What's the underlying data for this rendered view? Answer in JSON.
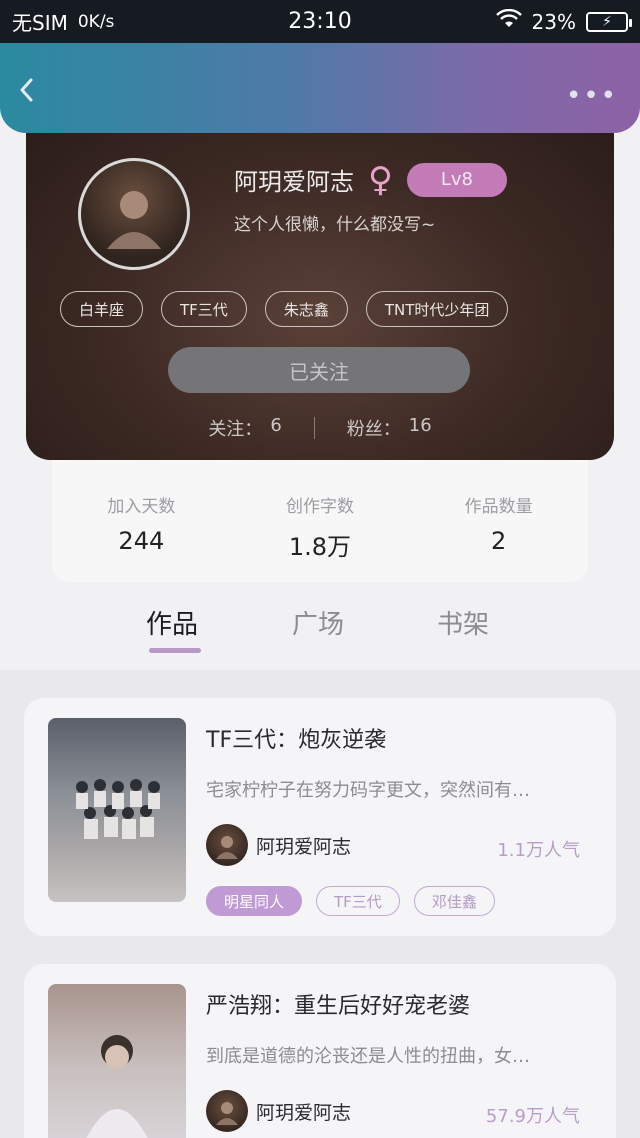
{
  "status_bar": {
    "carrier": "无SIM",
    "speed": "0K/s",
    "time": "23:10",
    "battery": "23%"
  },
  "header": {
    "back_icon": "chevron-left-icon",
    "more_icon": "more-dots-icon"
  },
  "profile": {
    "name": "阿玥爱阿志",
    "gender_symbol": "♀",
    "level": "Lv8",
    "bio": "这个人很懒，什么都没写~",
    "tags": [
      "白羊座",
      "TF三代",
      "朱志鑫",
      "TNT时代少年团"
    ],
    "follow_button": "已关注",
    "following_label": "关注：",
    "following_count": "6",
    "fans_label": "粉丝：",
    "fans_count": "16"
  },
  "stats": [
    {
      "label": "加入天数",
      "value": "244"
    },
    {
      "label": "创作字数",
      "value": "1.8万"
    },
    {
      "label": "作品数量",
      "value": "2"
    }
  ],
  "tabs": [
    "作品",
    "广场",
    "书架"
  ],
  "works": [
    {
      "title": "TF三代：炮灰逆袭",
      "description": "宅家柠柠子在努力码字更文，突然间有…",
      "author": "阿玥爱阿志",
      "popularity": "1.1万人气",
      "tags": [
        "明星同人",
        "TF三代",
        "邓佳鑫"
      ]
    },
    {
      "title": "严浩翔：重生后好好宠老婆",
      "description": "到底是道德的沦丧还是人性的扭曲，女…",
      "author": "阿玥爱阿志",
      "popularity": "57.9万人气",
      "tags": []
    }
  ],
  "colors": {
    "header_gradient_start": "#2a8aa0",
    "header_gradient_end": "#8d62a6",
    "accent_purple": "#c09ad4",
    "level_badge": "#c47cb8"
  }
}
